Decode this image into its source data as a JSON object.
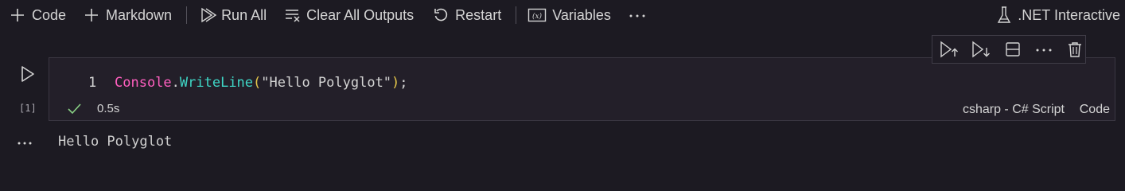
{
  "toolbar": {
    "code_label": "Code",
    "markdown_label": "Markdown",
    "run_all_label": "Run All",
    "clear_outputs_label": "Clear All Outputs",
    "restart_label": "Restart",
    "variables_label": "Variables",
    "more_icon": "ellipsis-icon"
  },
  "kernel": {
    "label": ".NET Interactive",
    "icon": "kernel-flask-icon"
  },
  "cell": {
    "execution_count": "[1]",
    "line_number": "1",
    "code": {
      "class_name": "Console",
      "dot": ".",
      "method": "WriteLine",
      "open_paren": "(",
      "string": "\"Hello Polyglot\"",
      "close_paren": ")",
      "semicolon": ";"
    },
    "duration": "0.5s",
    "language": "csharp - C# Script",
    "cell_type": "Code",
    "toolbar_icons": [
      "run-above-icon",
      "run-below-icon",
      "split-cell-icon",
      "more-icon",
      "delete-icon"
    ]
  },
  "output": {
    "text": "Hello Polyglot"
  },
  "colors": {
    "background": "#1c1a22",
    "cell_background": "#231f29",
    "class": "#ff5fbf",
    "method": "#3fd6c6",
    "paren": "#e6c84a",
    "success": "#89d185"
  }
}
